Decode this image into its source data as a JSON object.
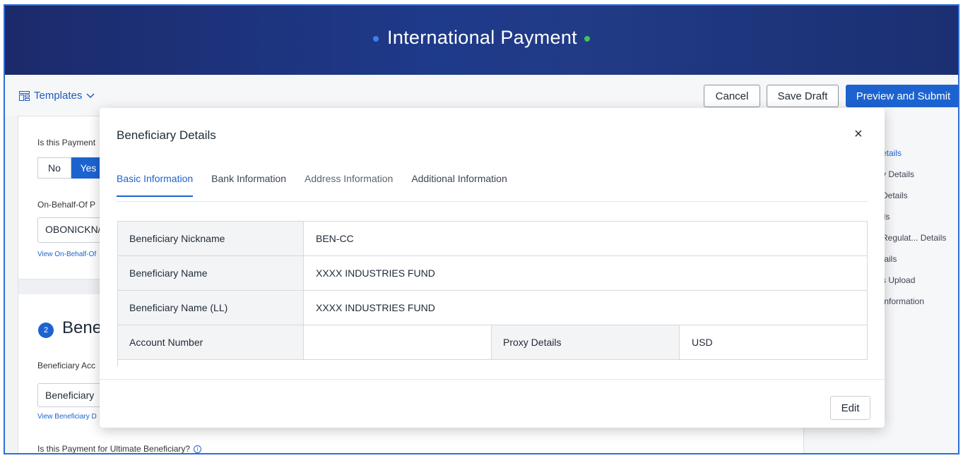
{
  "header": {
    "title": "International Payment"
  },
  "toolbar": {
    "templates_label": "Templates",
    "cancel_label": "Cancel",
    "save_draft_label": "Save Draft",
    "preview_submit_label": "Preview and Submit"
  },
  "form": {
    "payment_question": "Is this Payment",
    "toggle_no": "No",
    "toggle_yes": "Yes",
    "obo_label": "On-Behalf-Of P",
    "obo_value": "OBONICKN/",
    "obo_link": "View On-Behalf-Of",
    "step_number": "2",
    "step_title": "Bene",
    "ben_account_label": "Beneficiary Acc",
    "ben_account_value": "Beneficiary",
    "ben_link": "View Beneficiary D",
    "ultimate_question": "Is this Payment for Ultimate Beneficiary?"
  },
  "rightnav": {
    "items": [
      {
        "label": "etails"
      },
      {
        "label": "y Details"
      },
      {
        "label": "Details"
      },
      {
        "label": "ils"
      },
      {
        "label": "Regulat... Details"
      },
      {
        "label": "tails"
      },
      {
        "label": "s Upload"
      },
      {
        "label": "Information"
      }
    ]
  },
  "modal": {
    "title": "Beneficiary Details",
    "close_glyph": "×",
    "tabs": [
      {
        "label": "Basic Information"
      },
      {
        "label": "Bank Information"
      },
      {
        "label": "Address Information"
      },
      {
        "label": "Additional Information"
      }
    ],
    "rows": [
      {
        "label": "Beneficiary Nickname",
        "value": "BEN-CC"
      },
      {
        "label": "Beneficiary Name",
        "value": "XXXX INDUSTRIES FUND"
      },
      {
        "label": "Beneficiary Name (LL)",
        "value": "XXXX INDUSTRIES FUND"
      },
      {
        "label": "Account Number",
        "value": "",
        "label2": "Proxy Details",
        "value2": "USD"
      }
    ],
    "edit_label": "Edit"
  },
  "colors": {
    "brand_blue": "#1d63d0",
    "banner_navy": "#1e3a8a",
    "accent_green": "#43c25a"
  }
}
